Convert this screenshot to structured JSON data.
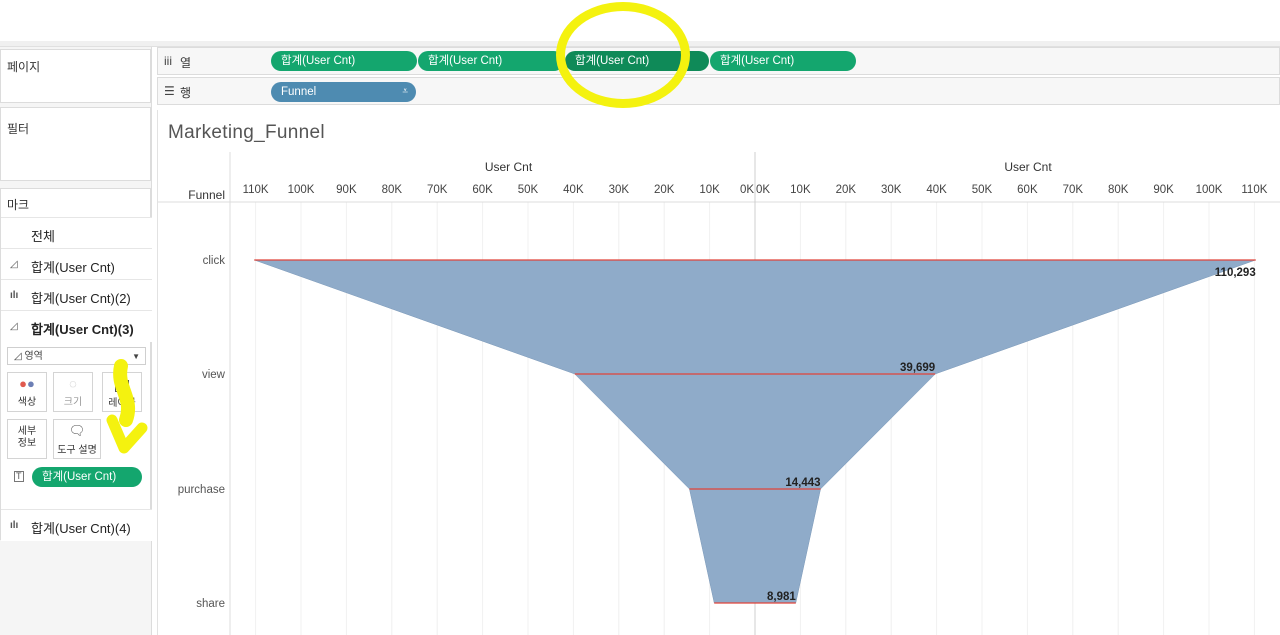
{
  "shelves": {
    "pages_title": "페이지",
    "columns": {
      "icon": "iii",
      "label": "열",
      "pills": [
        "합계(User Cnt)",
        "합계(User Cnt)",
        "합계(User Cnt)",
        "합계(User Cnt)"
      ]
    },
    "rows": {
      "icon": "☰",
      "label": "행",
      "pill": "Funnel",
      "sort_icon": "⩡"
    }
  },
  "filters_title": "필터",
  "marks": {
    "title": "마크",
    "items": [
      {
        "label": "전체",
        "icon": ""
      },
      {
        "label": "합계(User Cnt)",
        "icon": "area-icon"
      },
      {
        "label": "합계(User Cnt)(2)",
        "icon": "bar-icon"
      },
      {
        "label": "합계(User Cnt)(3)",
        "icon": "area-icon",
        "active": true
      }
    ],
    "mark_type": "영역",
    "buttons": {
      "color": "색상",
      "size": "크기",
      "label": "레이블",
      "detail": "세부\n정보",
      "tooltip": "도구 설명"
    },
    "label_pill": "합계(User Cnt)",
    "last_item": "합계(User Cnt)(4)"
  },
  "viz": {
    "title": "Marketing_Funnel",
    "row_header": "Funnel",
    "left_axis_title": "User Cnt",
    "right_axis_title": "User Cnt",
    "left_ticks": [
      "110K",
      "100K",
      "90K",
      "80K",
      "70K",
      "60K",
      "50K",
      "40K",
      "30K",
      "20K",
      "10K",
      "0K"
    ],
    "right_ticks": [
      "0K",
      "10K",
      "20K",
      "30K",
      "40K",
      "50K",
      "60K",
      "70K",
      "80K",
      "90K",
      "100K",
      "110K"
    ]
  },
  "chart_data": {
    "type": "area",
    "title": "Marketing_Funnel",
    "categories": [
      "click",
      "view",
      "purchase",
      "share"
    ],
    "series": [
      {
        "name": "합계(User Cnt)",
        "values": [
          110293,
          39699,
          14443,
          8981
        ]
      }
    ],
    "data_labels": [
      "110,293",
      "39,699",
      "14,443",
      "8,981"
    ],
    "xlabel": "User Cnt",
    "ylabel": "Funnel",
    "xlim": [
      0,
      110000
    ],
    "fill_color": "#8fabc9",
    "line_color": "#e0443a",
    "grid": true
  },
  "annotation_color": "#f4f20f"
}
